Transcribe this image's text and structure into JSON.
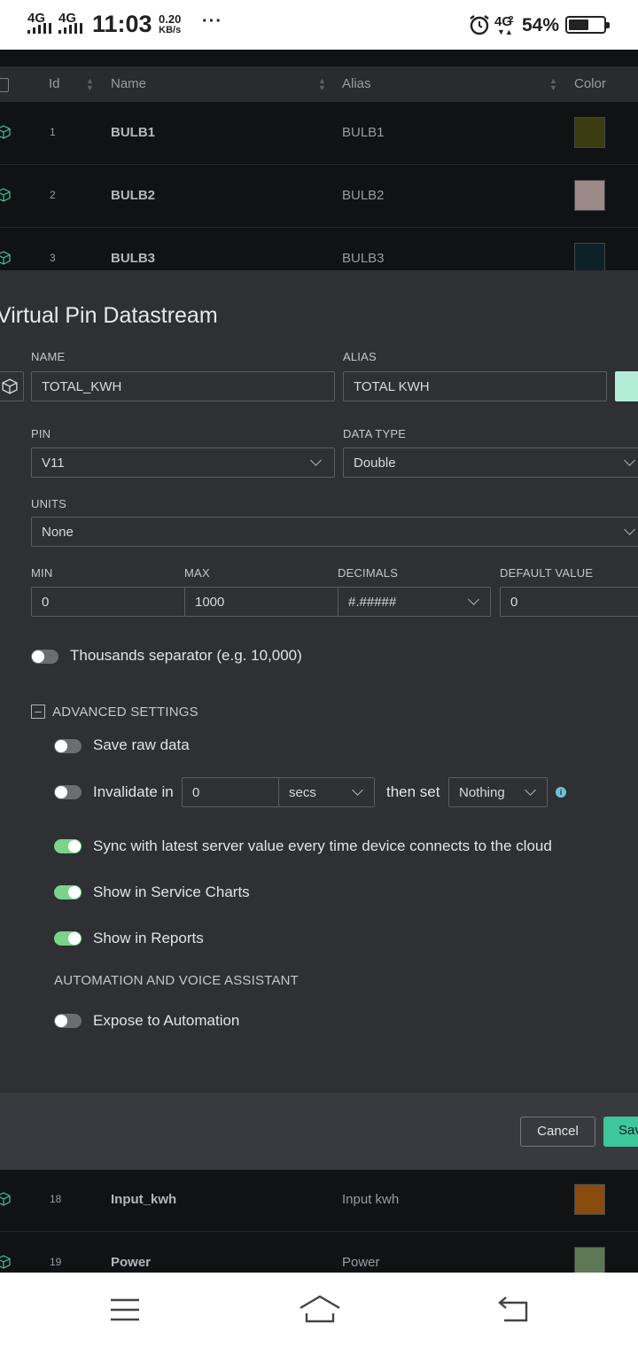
{
  "status_bar": {
    "signal1": "4G",
    "signal2": "4G",
    "time": "11:03",
    "speed_value": "0.20",
    "speed_unit": "KB/s",
    "more": "···",
    "network": "4G",
    "network_sub": "2",
    "battery": "54%"
  },
  "table": {
    "headers": {
      "id": "Id",
      "name": "Name",
      "alias": "Alias",
      "color": "Color"
    },
    "rows": [
      {
        "id": "1",
        "name": "BULB1",
        "alias": "BULB1",
        "color": "#3b3d10"
      },
      {
        "id": "2",
        "name": "BULB2",
        "alias": "BULB2",
        "color": "#9c8a88"
      },
      {
        "id": "3",
        "name": "BULB3",
        "alias": "BULB3",
        "color": "#0c2228"
      },
      {
        "id": "18",
        "name": "Input_kwh",
        "alias": "Input kwh",
        "color": "#8a4c0e"
      },
      {
        "id": "19",
        "name": "Power",
        "alias": "Power",
        "color": "#5e7755"
      }
    ]
  },
  "modal": {
    "title": "Virtual Pin Datastream",
    "name_label": "NAME",
    "name_value": "TOTAL_KWH",
    "alias_label": "ALIAS",
    "alias_value": "TOTAL KWH",
    "color_value": "#b3ecd6",
    "pin_label": "PIN",
    "pin_value": "V11",
    "datatype_label": "DATA TYPE",
    "datatype_value": "Double",
    "units_label": "UNITS",
    "units_value": "None",
    "min_label": "MIN",
    "min_value": "0",
    "max_label": "MAX",
    "max_value": "1000",
    "decimals_label": "DECIMALS",
    "decimals_value": "#.#####",
    "default_label": "DEFAULT VALUE",
    "default_value": "0",
    "thousands_label": "Thousands separator (e.g. 10,000)",
    "thousands_on": false,
    "advanced_label": "ADVANCED SETTINGS",
    "save_raw_label": "Save raw data",
    "save_raw_on": false,
    "invalidate_label": "Invalidate in",
    "invalidate_on": false,
    "invalidate_value": "0",
    "invalidate_unit": "secs",
    "then_set_label": "then set",
    "then_set_value": "Nothing",
    "sync_label": "Sync with latest server value every time device connects to the cloud",
    "sync_on": true,
    "service_charts_label": "Show in Service Charts",
    "service_charts_on": true,
    "reports_label": "Show in Reports",
    "reports_on": true,
    "automation_section_label": "AUTOMATION AND VOICE ASSISTANT",
    "expose_label": "Expose to Automation",
    "expose_on": false,
    "cancel_label": "Cancel",
    "save_label": "Sav"
  },
  "colors": {
    "accent": "#3ec79a",
    "toggle_on": "#7bd389",
    "info_icon": "#6cc1d9"
  }
}
